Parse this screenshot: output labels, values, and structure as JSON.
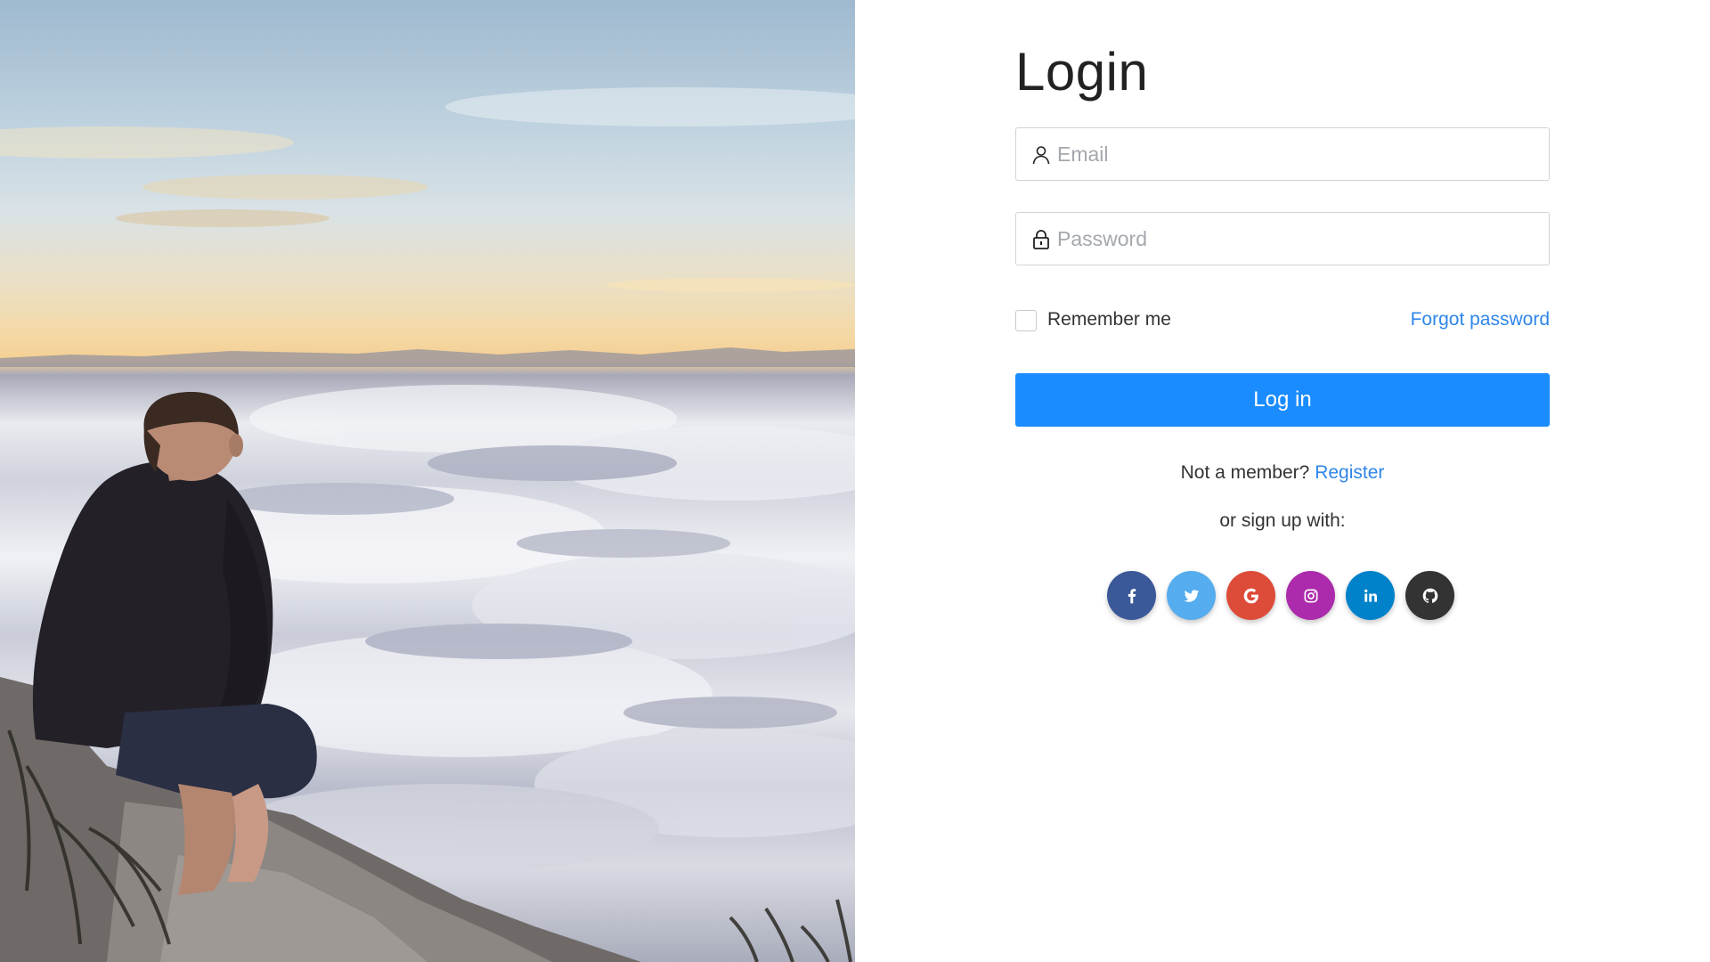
{
  "hero": {
    "image_alt": "Person sitting on a cliff looking over a sea of clouds at sunrise"
  },
  "login": {
    "title": "Login",
    "email_placeholder": "Email",
    "password_placeholder": "Password",
    "remember_label": "Remember me",
    "forgot_label": "Forgot password",
    "submit_label": "Log in",
    "member_text": "Not a member?",
    "register_label": "Register",
    "signup_text": "or sign up with:"
  },
  "social": [
    {
      "name": "facebook",
      "icon": "facebook-icon",
      "color": "#3b5998"
    },
    {
      "name": "twitter",
      "icon": "twitter-icon",
      "color": "#55acee"
    },
    {
      "name": "google",
      "icon": "google-icon",
      "color": "#dd4b39"
    },
    {
      "name": "instagram",
      "icon": "instagram-icon",
      "color": "#ac2bac"
    },
    {
      "name": "linkedin",
      "icon": "linkedin-icon",
      "color": "#0082ca"
    },
    {
      "name": "github",
      "icon": "github-icon",
      "color": "#333333"
    }
  ],
  "colors": {
    "primary": "#1a8cff",
    "link": "#2f86e8",
    "input_border": "#cfd4d9"
  }
}
